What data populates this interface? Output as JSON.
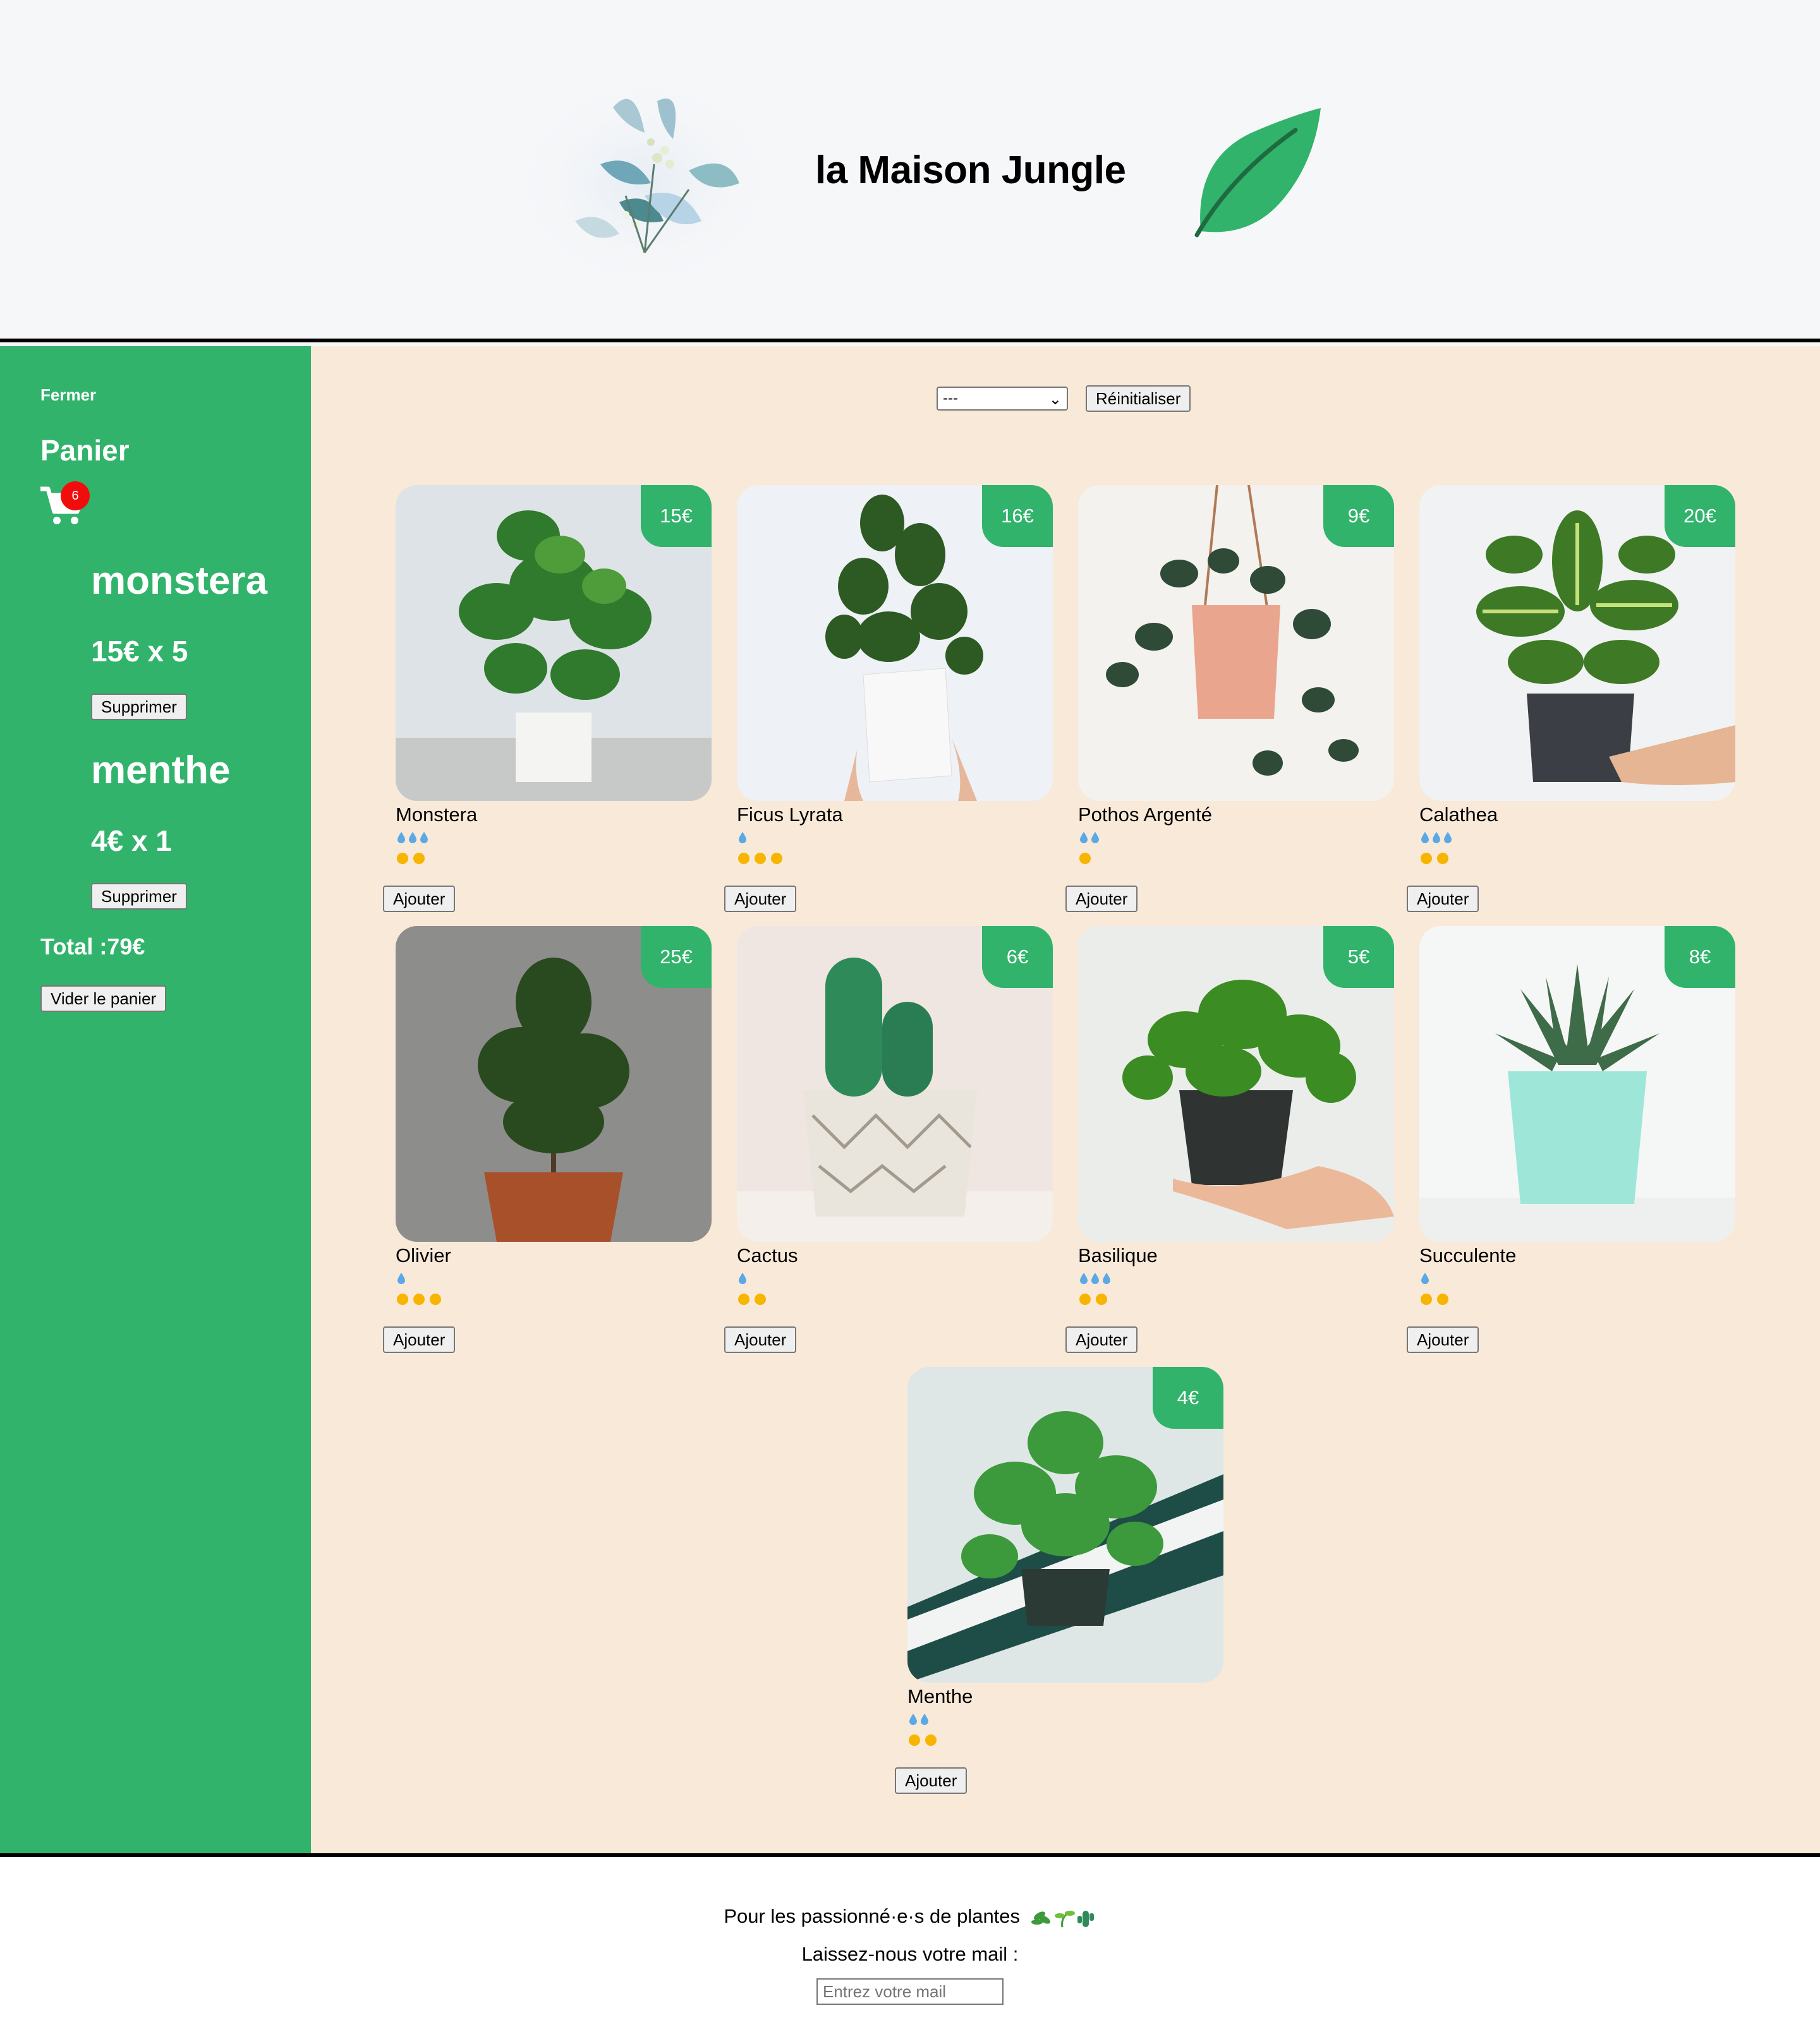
{
  "header": {
    "title": "la Maison Jungle"
  },
  "cart": {
    "close_label": "Fermer",
    "title": "Panier",
    "badge_count": "6",
    "items": [
      {
        "name": "monstera",
        "price_line": "15€ x 5",
        "remove_label": "Supprimer"
      },
      {
        "name": "menthe",
        "price_line": "4€ x 1",
        "remove_label": "Supprimer"
      }
    ],
    "total": "Total :79€",
    "clear_label": "Vider le panier"
  },
  "filters": {
    "selected": "---",
    "reset_label": "Réinitialiser"
  },
  "plants": [
    {
      "name": "Monstera",
      "price": "15€",
      "water": 3,
      "light": 2,
      "add_label": "Ajouter"
    },
    {
      "name": "Ficus Lyrata",
      "price": "16€",
      "water": 1,
      "light": 3,
      "add_label": "Ajouter"
    },
    {
      "name": "Pothos Argenté",
      "price": "9€",
      "water": 2,
      "light": 1,
      "add_label": "Ajouter"
    },
    {
      "name": "Calathea",
      "price": "20€",
      "water": 3,
      "light": 2,
      "add_label": "Ajouter"
    },
    {
      "name": "Olivier",
      "price": "25€",
      "water": 1,
      "light": 3,
      "add_label": "Ajouter"
    },
    {
      "name": "Cactus",
      "price": "6€",
      "water": 1,
      "light": 2,
      "add_label": "Ajouter"
    },
    {
      "name": "Basilique",
      "price": "5€",
      "water": 3,
      "light": 2,
      "add_label": "Ajouter"
    },
    {
      "name": "Succulente",
      "price": "8€",
      "water": 1,
      "light": 2,
      "add_label": "Ajouter"
    },
    {
      "name": "Menthe",
      "price": "4€",
      "water": 2,
      "light": 2,
      "add_label": "Ajouter"
    }
  ],
  "footer": {
    "slogan": "Pour les passionné·e·s de plantes",
    "mail_label": "Laissez-nous votre mail :",
    "mail_placeholder": "Entrez votre mail",
    "mail_value": ""
  },
  "colors": {
    "brand_green": "#31b36b",
    "main_bg": "#f9e9d8",
    "badge_red": "#f20d0d",
    "sun_yellow": "#f7b500",
    "water_blue": "#5aa9e6"
  }
}
